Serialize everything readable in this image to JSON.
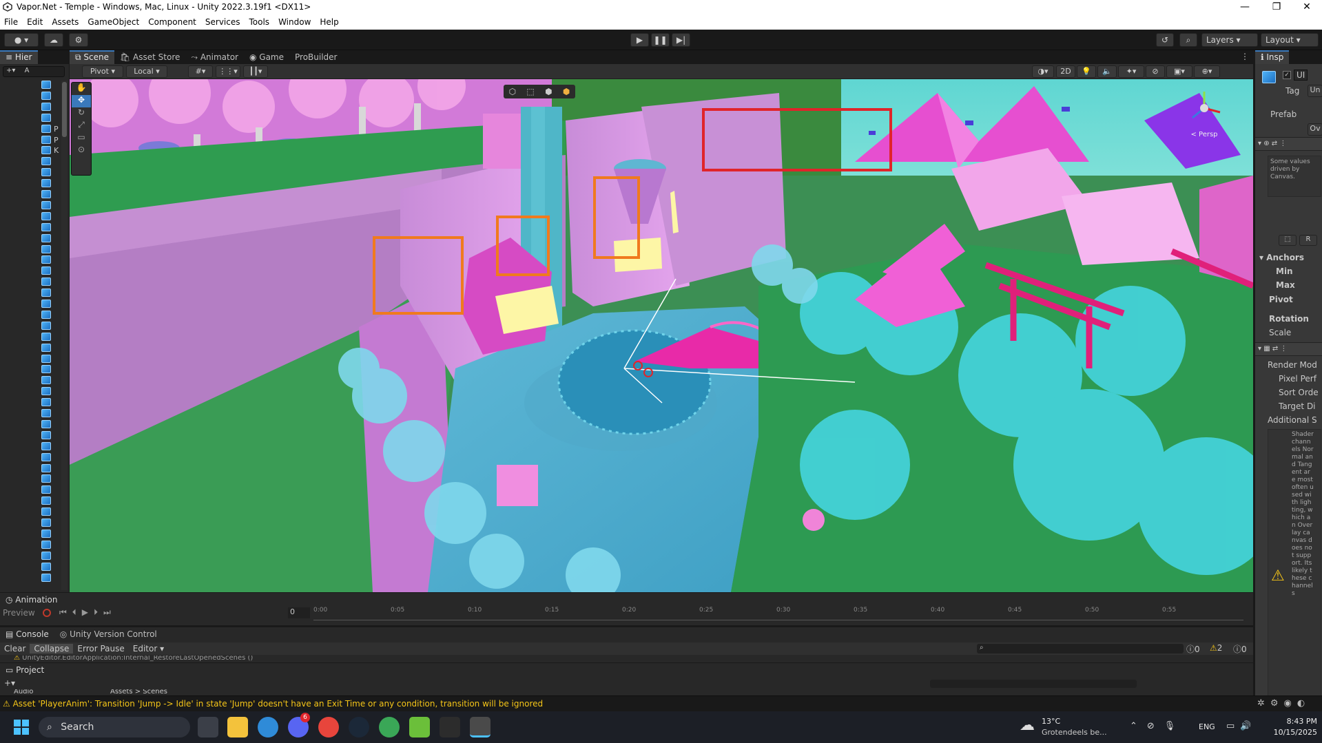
{
  "window": {
    "title": "Vapor.Net - Temple - Windows, Mac, Linux - Unity 2022.3.19f1 <DX11>",
    "minimize": "—",
    "maximize": "❐",
    "close": "✕"
  },
  "menu": [
    "File",
    "Edit",
    "Assets",
    "GameObject",
    "Component",
    "Services",
    "Tools",
    "Window",
    "Help"
  ],
  "toolbar": {
    "layers_label": "Layers",
    "layout_label": "Layout"
  },
  "hierarchy": {
    "tab_label": "Hier",
    "search_placeholder": "A",
    "items": [
      "",
      "",
      "",
      "",
      "P",
      "P",
      "K"
    ]
  },
  "scene_tabs": {
    "scene": "Scene",
    "asset_store": "Asset Store",
    "animator": "Animator",
    "game": "Game",
    "probuilder": "ProBuilder"
  },
  "scene_toolbar": {
    "pivot": "Pivot",
    "local": "Local",
    "mode_2d": "2D"
  },
  "gizmo": {
    "persp_label": "< Persp"
  },
  "inspector": {
    "tab_label": "Insp",
    "name_short": "UI",
    "tag_label": "Tag",
    "tag_value": "Un",
    "prefab_label": "Prefab",
    "overrides": "Ov",
    "driven_note": "Some values driven by Canvas.",
    "reset_btn": "R",
    "anchors": "Anchors",
    "min": "Min",
    "max": "Max",
    "pivot": "Pivot",
    "rotation": "Rotation",
    "scale": "Scale",
    "render_mode": "Render Mod",
    "pixel_perfect": "Pixel Perf",
    "sort_order": "Sort Orde",
    "target_display": "Target Di",
    "additional": "Additional S",
    "warning_text": "Shader channels Normal and Tangent are most often used with lighting, which an Overlay canvas does not support. Its likely these channels"
  },
  "animation": {
    "tab_label": "Animation",
    "preview_label": "Preview",
    "frame_value": "0",
    "ticks": [
      "0:00",
      "0:05",
      "0:10",
      "0:15",
      "0:20",
      "0:25",
      "0:30",
      "0:35",
      "0:40",
      "0:45",
      "0:50",
      "0:55"
    ]
  },
  "console": {
    "tab_label": "Console",
    "uvc_tab": "Unity Version Control",
    "clear": "Clear",
    "collapse": "Collapse",
    "error_pause": "Error Pause",
    "editor": "Editor",
    "log_line": "UnityEditor.EditorApplication:Internal_RestoreLastOpenedScenes ()",
    "count_info": "0",
    "count_warn": "2",
    "count_error": "0"
  },
  "project": {
    "tab_label": "Project",
    "folder": "Audio",
    "path": "Assets > Scenes"
  },
  "status": {
    "message": "Asset 'PlayerAnim': Transition 'Jump -> Idle' in state 'Jump' doesn't have an Exit Time or any condition, transition will be ignored"
  },
  "taskbar": {
    "search_label": "Search",
    "discord_badge": "6",
    "weather_temp": "13°C",
    "weather_desc": "Grotendeels be...",
    "lang": "ENG",
    "time": "8:43 PM",
    "date": "10/15/2025"
  },
  "colors": {
    "accent": "#3a79bb",
    "highlight_red": "#e0242a",
    "highlight_orange": "#f07a1e",
    "warning": "#f5c518"
  }
}
